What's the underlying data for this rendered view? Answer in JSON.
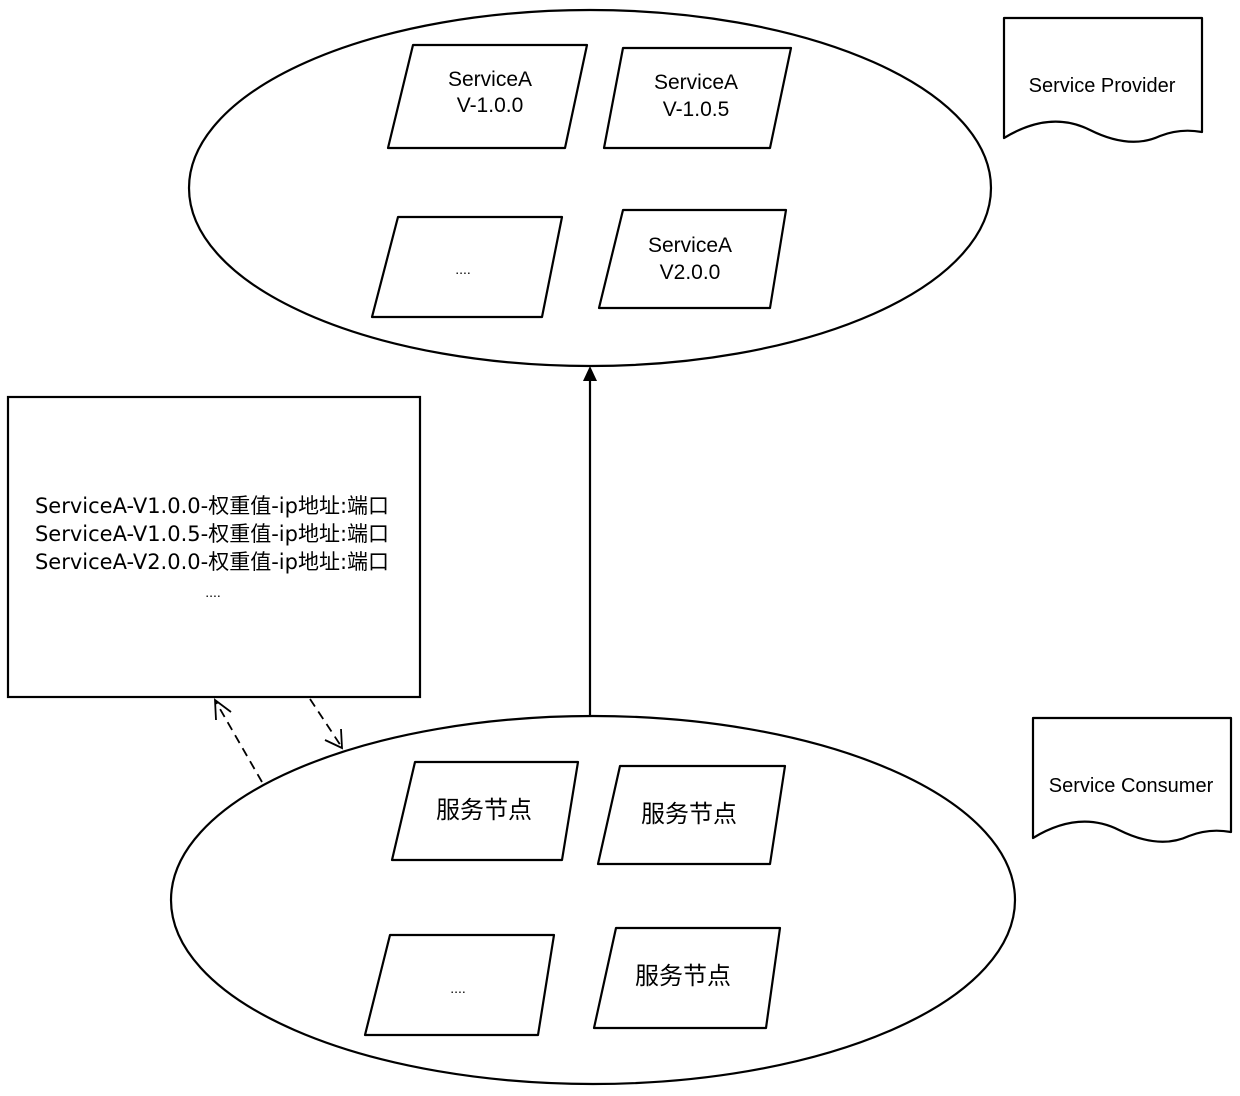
{
  "provider": {
    "label": "Service Provider",
    "nodes": [
      {
        "lines": [
          "ServiceA",
          "V-1.0.0"
        ]
      },
      {
        "lines": [
          "ServiceA",
          "V-1.0.5"
        ]
      },
      {
        "lines": [
          "...."
        ]
      },
      {
        "lines": [
          "ServiceA",
          "V2.0.0"
        ]
      }
    ]
  },
  "consumer": {
    "label": "Service Consumer",
    "nodes": [
      {
        "lines": [
          "服务节点"
        ]
      },
      {
        "lines": [
          "服务节点"
        ]
      },
      {
        "lines": [
          "...."
        ]
      },
      {
        "lines": [
          "服务节点"
        ]
      }
    ]
  },
  "registry": {
    "entries": [
      "ServiceA-V1.0.0-权重值-ip地址:端口",
      "ServiceA-V1.0.5-权重值-ip地址:端口",
      "ServiceA-V2.0.0-权重值-ip地址:端口",
      "...."
    ]
  },
  "connections": [
    {
      "from": "consumer",
      "to": "provider",
      "style": "solid",
      "arrow": "filled"
    },
    {
      "from": "consumer",
      "to": "registry",
      "style": "dashed",
      "arrow": "open"
    },
    {
      "from": "registry",
      "to": "consumer",
      "style": "dashed",
      "arrow": "open"
    }
  ]
}
